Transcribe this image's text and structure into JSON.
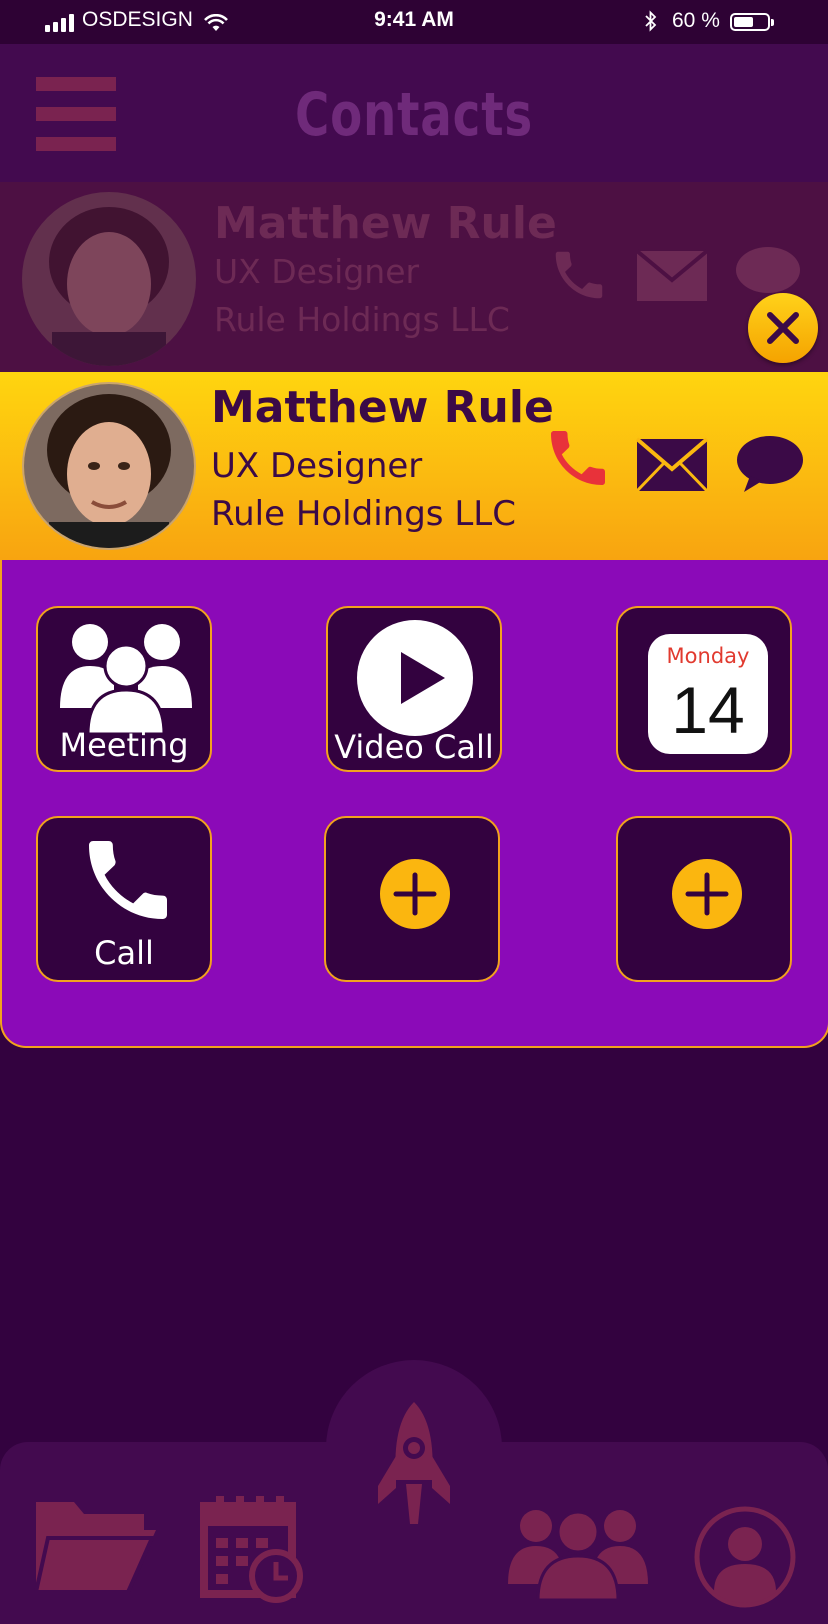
{
  "status_bar": {
    "carrier": "OSDESIGN",
    "time": "9:41 AM",
    "battery_percent": "60 %",
    "battery_level": 0.6
  },
  "header": {
    "title": "Contacts",
    "menu_icon": "hamburger-icon"
  },
  "dimmed_contact": {
    "name": "Matthew Rule",
    "title": "UX Designer",
    "company": "Rule Holdings LLC"
  },
  "active_contact": {
    "name": "Matthew Rule",
    "title": "UX Designer",
    "company": "Rule Holdings LLC",
    "actions": [
      "phone-icon",
      "mail-icon",
      "chat-icon"
    ]
  },
  "actions_grid": {
    "meeting_label": "Meeting",
    "video_call_label": "Video Call",
    "calendar_day": "Monday",
    "calendar_date": "14",
    "call_label": "Call"
  },
  "tab_bar": {
    "items": [
      "folder-icon",
      "calendar-clock-icon",
      "rocket-icon",
      "group-icon",
      "profile-icon"
    ]
  },
  "colors": {
    "background": "#33023f",
    "header": "#430a4f",
    "card_gradient_top": "#ffd50f",
    "card_gradient_bottom": "#f8a410",
    "panel": "#8b0ab8",
    "accent_orange": "#f2a21e",
    "phone_red": "#e8323a"
  }
}
